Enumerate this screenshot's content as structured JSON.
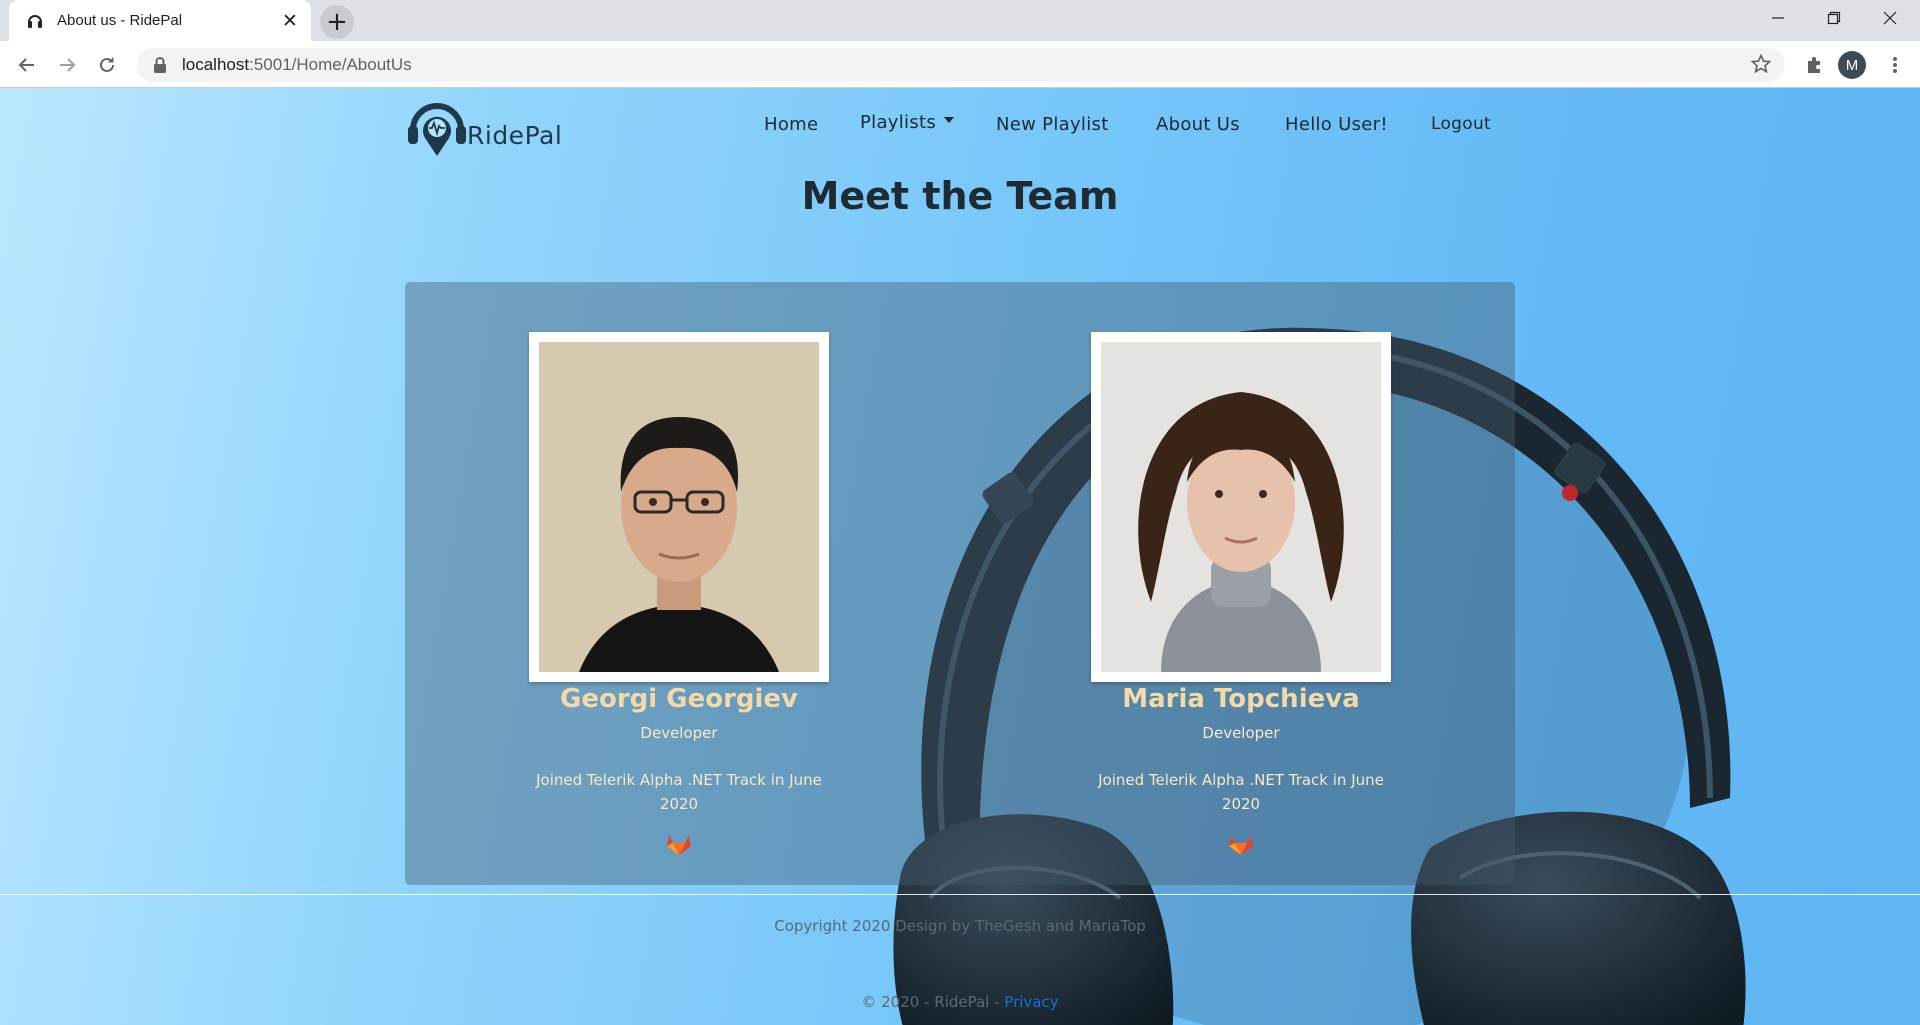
{
  "browser": {
    "tab_title": "About us - RidePal",
    "tab_close": "✕",
    "new_tab": "+",
    "url_host": "localhost",
    "url_path": ":5001/Home/AboutUs",
    "profile_initial": "M"
  },
  "site": {
    "logo_text": "RidePal",
    "nav": {
      "home": "Home",
      "playlists": "Playlists",
      "new_playlist": "New Playlist",
      "about_us": "About Us",
      "greeting": "Hello User!",
      "logout": "Logout"
    },
    "page_title": "Meet the Team",
    "members": [
      {
        "name": "Georgi Georgiev",
        "role": "Developer",
        "bio": "Joined Telerik Alpha .NET Track in June 2020"
      },
      {
        "name": "Maria Topchieva",
        "role": "Developer",
        "bio": "Joined Telerik Alpha .NET Track in June 2020"
      }
    ],
    "copyright": "Copyright 2020 Design by TheGesh and MariaTop",
    "footer_prefix": "© 2020 - RidePal - ",
    "privacy": "Privacy"
  },
  "colors": {
    "accent_name": "#f6d9a6",
    "gitlab": "#e24329",
    "link": "#1a6fd6"
  },
  "icons": [
    "headphones-favicon",
    "close-icon",
    "plus-icon",
    "minimize-icon",
    "restore-icon",
    "close-window-icon",
    "back-arrow-icon",
    "forward-arrow-icon",
    "reload-icon",
    "lock-icon",
    "star-icon",
    "extensions-icon",
    "more-icon",
    "gitlab-icon"
  ]
}
